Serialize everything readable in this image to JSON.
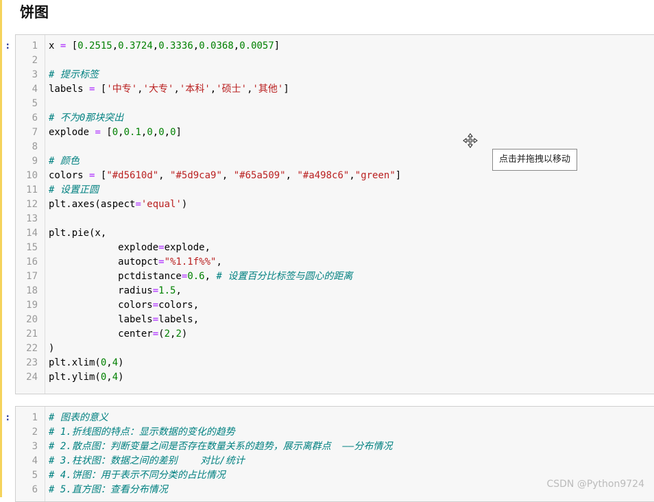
{
  "heading": "饼图",
  "prompt_symbol": ":",
  "cell1": {
    "lines": [
      [
        {
          "t": "x ",
          "c": "plain"
        },
        {
          "t": "=",
          "c": "op"
        },
        {
          "t": " [",
          "c": "plain"
        },
        {
          "t": "0.2515",
          "c": "num"
        },
        {
          "t": ",",
          "c": "plain"
        },
        {
          "t": "0.3724",
          "c": "num"
        },
        {
          "t": ",",
          "c": "plain"
        },
        {
          "t": "0.3336",
          "c": "num"
        },
        {
          "t": ",",
          "c": "plain"
        },
        {
          "t": "0.0368",
          "c": "num"
        },
        {
          "t": ",",
          "c": "plain"
        },
        {
          "t": "0.0057",
          "c": "num"
        },
        {
          "t": "]",
          "c": "plain"
        }
      ],
      [],
      [
        {
          "t": "# 提示标签",
          "c": "cmt"
        }
      ],
      [
        {
          "t": "labels ",
          "c": "plain"
        },
        {
          "t": "=",
          "c": "op"
        },
        {
          "t": " [",
          "c": "plain"
        },
        {
          "t": "'中专'",
          "c": "str"
        },
        {
          "t": ",",
          "c": "plain"
        },
        {
          "t": "'大专'",
          "c": "str"
        },
        {
          "t": ",",
          "c": "plain"
        },
        {
          "t": "'本科'",
          "c": "str"
        },
        {
          "t": ",",
          "c": "plain"
        },
        {
          "t": "'硕士'",
          "c": "str"
        },
        {
          "t": ",",
          "c": "plain"
        },
        {
          "t": "'其他'",
          "c": "str"
        },
        {
          "t": "]",
          "c": "plain"
        }
      ],
      [],
      [
        {
          "t": "# 不为0那块突出",
          "c": "cmt"
        }
      ],
      [
        {
          "t": "explode ",
          "c": "plain"
        },
        {
          "t": "=",
          "c": "op"
        },
        {
          "t": " [",
          "c": "plain"
        },
        {
          "t": "0",
          "c": "num"
        },
        {
          "t": ",",
          "c": "plain"
        },
        {
          "t": "0.1",
          "c": "num"
        },
        {
          "t": ",",
          "c": "plain"
        },
        {
          "t": "0",
          "c": "num"
        },
        {
          "t": ",",
          "c": "plain"
        },
        {
          "t": "0",
          "c": "num"
        },
        {
          "t": ",",
          "c": "plain"
        },
        {
          "t": "0",
          "c": "num"
        },
        {
          "t": "]",
          "c": "plain"
        }
      ],
      [],
      [
        {
          "t": "# 颜色",
          "c": "cmt"
        }
      ],
      [
        {
          "t": "colors ",
          "c": "plain"
        },
        {
          "t": "=",
          "c": "op"
        },
        {
          "t": " [",
          "c": "plain"
        },
        {
          "t": "\"#d5610d\"",
          "c": "str"
        },
        {
          "t": ", ",
          "c": "plain"
        },
        {
          "t": "\"#5d9ca9\"",
          "c": "str"
        },
        {
          "t": ", ",
          "c": "plain"
        },
        {
          "t": "\"#65a509\"",
          "c": "str"
        },
        {
          "t": ", ",
          "c": "plain"
        },
        {
          "t": "\"#a498c6\"",
          "c": "str"
        },
        {
          "t": ",",
          "c": "plain"
        },
        {
          "t": "\"green\"",
          "c": "str"
        },
        {
          "t": "]",
          "c": "plain"
        }
      ],
      [
        {
          "t": "# 设置正圆",
          "c": "cmt"
        }
      ],
      [
        {
          "t": "plt.axes(aspect",
          "c": "plain"
        },
        {
          "t": "=",
          "c": "op"
        },
        {
          "t": "'equal'",
          "c": "str"
        },
        {
          "t": ")",
          "c": "plain"
        }
      ],
      [],
      [
        {
          "t": "plt.pie(x,",
          "c": "plain"
        }
      ],
      [
        {
          "t": "            explode",
          "c": "plain"
        },
        {
          "t": "=",
          "c": "op"
        },
        {
          "t": "explode,",
          "c": "plain"
        }
      ],
      [
        {
          "t": "            autopct",
          "c": "plain"
        },
        {
          "t": "=",
          "c": "op"
        },
        {
          "t": "\"%1.1f%%\"",
          "c": "str"
        },
        {
          "t": ",",
          "c": "plain"
        }
      ],
      [
        {
          "t": "            pctdistance",
          "c": "plain"
        },
        {
          "t": "=",
          "c": "op"
        },
        {
          "t": "0.6",
          "c": "num"
        },
        {
          "t": ", ",
          "c": "plain"
        },
        {
          "t": "# 设置百分比标签与圆心的距离",
          "c": "cmt"
        }
      ],
      [
        {
          "t": "            radius",
          "c": "plain"
        },
        {
          "t": "=",
          "c": "op"
        },
        {
          "t": "1.5",
          "c": "num"
        },
        {
          "t": ",",
          "c": "plain"
        }
      ],
      [
        {
          "t": "            colors",
          "c": "plain"
        },
        {
          "t": "=",
          "c": "op"
        },
        {
          "t": "colors,",
          "c": "plain"
        }
      ],
      [
        {
          "t": "            labels",
          "c": "plain"
        },
        {
          "t": "=",
          "c": "op"
        },
        {
          "t": "labels,",
          "c": "plain"
        }
      ],
      [
        {
          "t": "            center",
          "c": "plain"
        },
        {
          "t": "=",
          "c": "op"
        },
        {
          "t": "(",
          "c": "plain"
        },
        {
          "t": "2",
          "c": "num"
        },
        {
          "t": ",",
          "c": "plain"
        },
        {
          "t": "2",
          "c": "num"
        },
        {
          "t": ")",
          "c": "plain"
        }
      ],
      [
        {
          "t": ")",
          "c": "plain"
        }
      ],
      [
        {
          "t": "plt.xlim(",
          "c": "plain"
        },
        {
          "t": "0",
          "c": "num"
        },
        {
          "t": ",",
          "c": "plain"
        },
        {
          "t": "4",
          "c": "num"
        },
        {
          "t": ")",
          "c": "plain"
        }
      ],
      [
        {
          "t": "plt.ylim(",
          "c": "plain"
        },
        {
          "t": "0",
          "c": "num"
        },
        {
          "t": ",",
          "c": "plain"
        },
        {
          "t": "4",
          "c": "num"
        },
        {
          "t": ")",
          "c": "plain"
        }
      ]
    ]
  },
  "cell2": {
    "lines": [
      [
        {
          "t": "# 图表的意义",
          "c": "cmt"
        }
      ],
      [
        {
          "t": "# 1.折线图的特点：显示数据的变化的趋势",
          "c": "cmt"
        }
      ],
      [
        {
          "t": "# 2.散点图：判断变量之间是否存在数量关系的趋势，展示离群点  ——分布情况",
          "c": "cmt"
        }
      ],
      [
        {
          "t": "# 3.柱状图：数据之间的差别    对比/统计",
          "c": "cmt"
        }
      ],
      [
        {
          "t": "# 4.饼图：用于表示不同分类的占比情况",
          "c": "cmt"
        }
      ],
      [
        {
          "t": "# 5.直方图：查看分布情况",
          "c": "cmt"
        }
      ]
    ]
  },
  "tooltip": "点击并拖拽以移动",
  "move_icon": "move-cursor-icon",
  "watermark": "CSDN @Python9724"
}
